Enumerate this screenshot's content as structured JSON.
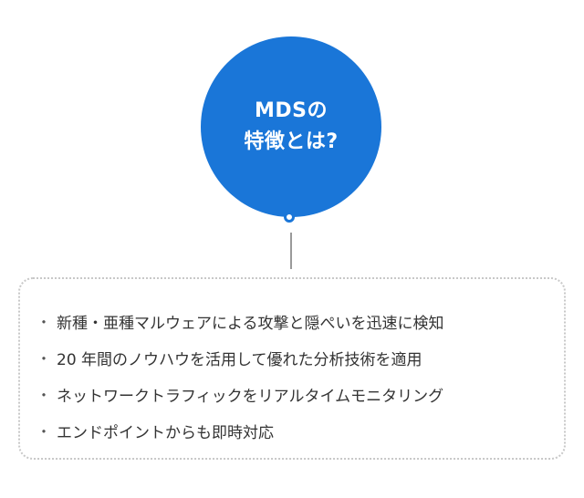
{
  "badge": {
    "line1": "MDSの",
    "line2": "特徴とは?"
  },
  "colors": {
    "accent": "#1a76d8",
    "text": "#333333",
    "border": "#c8c8c8"
  },
  "features": [
    "新種・亜種マルウェアによる攻撃と隠ぺいを迅速に検知",
    "20 年間のノウハウを活用して優れた分析技術を適用",
    "ネットワークトラフィックをリアルタイムモニタリング",
    "エンドポイントからも即時対応"
  ],
  "bullet_symbol": "・"
}
